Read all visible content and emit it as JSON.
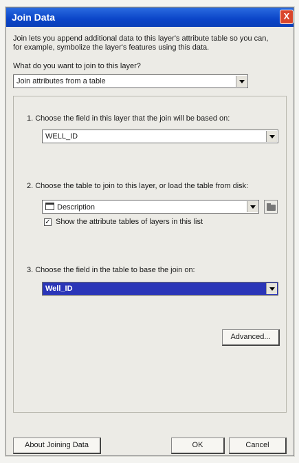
{
  "dialog": {
    "title": "Join Data",
    "close_label": "X",
    "intro_line1": "Join lets you append additional data to this layer's attribute table so you can,",
    "intro_line2": "for example, symbolize the layer's features using this data.",
    "question": "What do you want to join to this layer?",
    "join_type_value": "Join attributes from a table"
  },
  "step1": {
    "label": "1.  Choose the field in this layer that the join will be based on:",
    "field_value": "WELL_ID"
  },
  "step2": {
    "label": "2.  Choose the table to join to this layer, or load the table from disk:",
    "table_value": "Description",
    "checkbox_label": "Show the attribute tables of layers in this list",
    "checkbox_checked": true
  },
  "step3": {
    "label": "3.  Choose the field in the table to base the join on:",
    "field_value": "Well_ID"
  },
  "buttons": {
    "advanced": "Advanced...",
    "about": "About Joining Data",
    "ok": "OK",
    "cancel": "Cancel"
  }
}
